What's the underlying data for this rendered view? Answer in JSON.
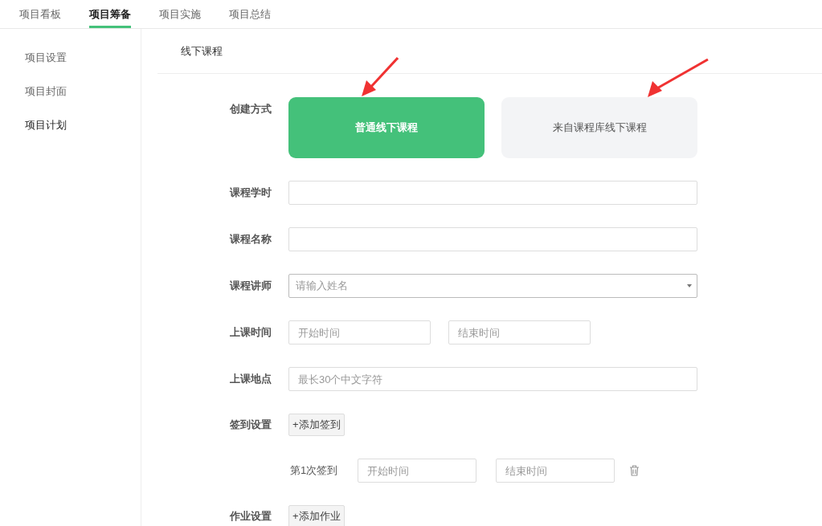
{
  "tabs": [
    {
      "label": "项目看板",
      "selected": false
    },
    {
      "label": "项目筹备",
      "selected": true
    },
    {
      "label": "项目实施",
      "selected": false
    },
    {
      "label": "项目总结",
      "selected": false
    }
  ],
  "sidebar": {
    "items": [
      {
        "label": "项目设置",
        "selected": false
      },
      {
        "label": "项目封面",
        "selected": false
      },
      {
        "label": "项目计划",
        "selected": true
      }
    ]
  },
  "section_title": "线下课程",
  "form": {
    "rows": [
      {
        "kind": "choice",
        "label": "创建方式",
        "options": [
          {
            "label": "普通线下课程",
            "selected": true
          },
          {
            "label": "来自课程库线下课程",
            "selected": false
          }
        ]
      },
      {
        "kind": "text",
        "label": "课程学时"
      },
      {
        "kind": "text",
        "label": "课程名称"
      },
      {
        "kind": "select",
        "label": "课程讲师",
        "placeholder": "请输入姓名"
      },
      {
        "kind": "range",
        "label": "上课时间",
        "start_placeholder": "开始时间",
        "end_placeholder": "结束时间"
      },
      {
        "kind": "text",
        "label": "上课地点",
        "placeholder": "最长30个中文字符"
      },
      {
        "kind": "button",
        "label": "签到设置",
        "button": "+添加签到"
      },
      {
        "kind": "signin",
        "label": "第1次签到",
        "start_placeholder": "开始时间",
        "end_placeholder": "结束时间"
      },
      {
        "kind": "button",
        "label": "作业设置",
        "button": "+添加作业"
      }
    ]
  }
}
